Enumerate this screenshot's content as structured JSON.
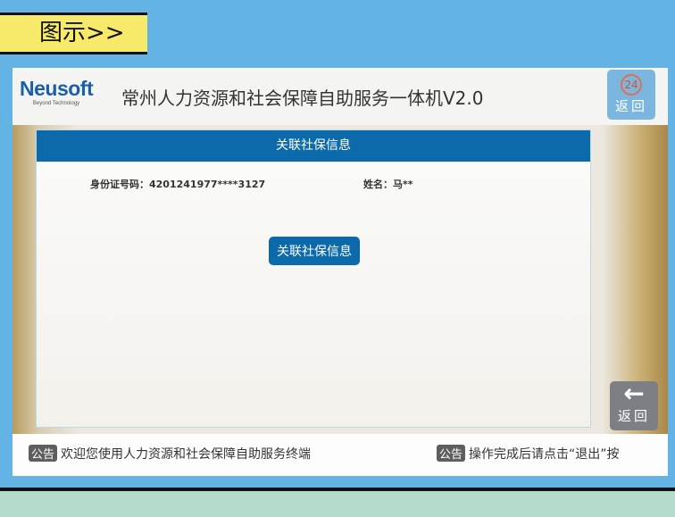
{
  "tag_label": "图示>>",
  "header": {
    "logo": "Neusoft",
    "logo_tagline": "Beyond Technology",
    "title": "常州人力资源和社会保障自助服务一体机V2.0",
    "timer": "24",
    "timer_back_label": "返回"
  },
  "dialog": {
    "title": "关联社保信息",
    "id_label": "身份证号码：",
    "id_value": "4201241977****3127",
    "name_label": "姓名：",
    "name_value": "马**",
    "button": "关联社保信息"
  },
  "back_button": {
    "arrow": "←",
    "label": "返回"
  },
  "footer": {
    "notices": [
      {
        "badge": "公告",
        "text": "欢迎您使用人力资源和社会保障自助服务终端"
      },
      {
        "badge": "公告",
        "text": "操作完成后请点击“退出”按"
      }
    ]
  }
}
